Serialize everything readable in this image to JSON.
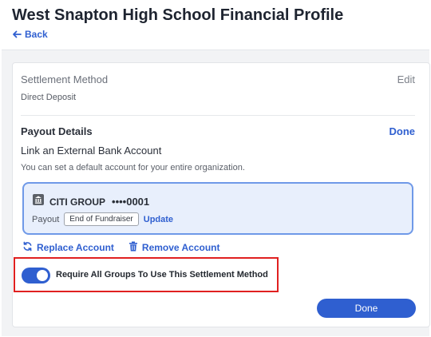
{
  "header": {
    "title": "West Snapton High School Financial Profile",
    "back_label": "Back"
  },
  "settlement": {
    "label": "Settlement Method",
    "edit_label": "Edit",
    "value": "Direct Deposit"
  },
  "payout": {
    "title": "Payout Details",
    "done_label": "Done",
    "link_title": "Link an External Bank Account",
    "link_subtitle": "You can set a default account for your entire organization."
  },
  "bank_account": {
    "bank_name": "CITI GROUP",
    "account_masked": "••••0001",
    "payout_label": "Payout",
    "payout_schedule": "End of Fundraiser",
    "update_label": "Update"
  },
  "actions": {
    "replace_label": "Replace Account",
    "remove_label": "Remove Account"
  },
  "require_toggle": {
    "label": "Require All Groups To Use This Settlement Method",
    "enabled": true
  },
  "footer": {
    "done_button_label": "Done"
  },
  "colors": {
    "accent": "#2f5fd0",
    "highlight_border": "#e02020",
    "bank_card_bg": "#e8effc",
    "bank_card_border": "#6f99e8"
  },
  "icons": {
    "back": "arrow-left-icon",
    "bank": "bank-icon",
    "replace": "refresh-icon",
    "remove": "trash-icon"
  }
}
